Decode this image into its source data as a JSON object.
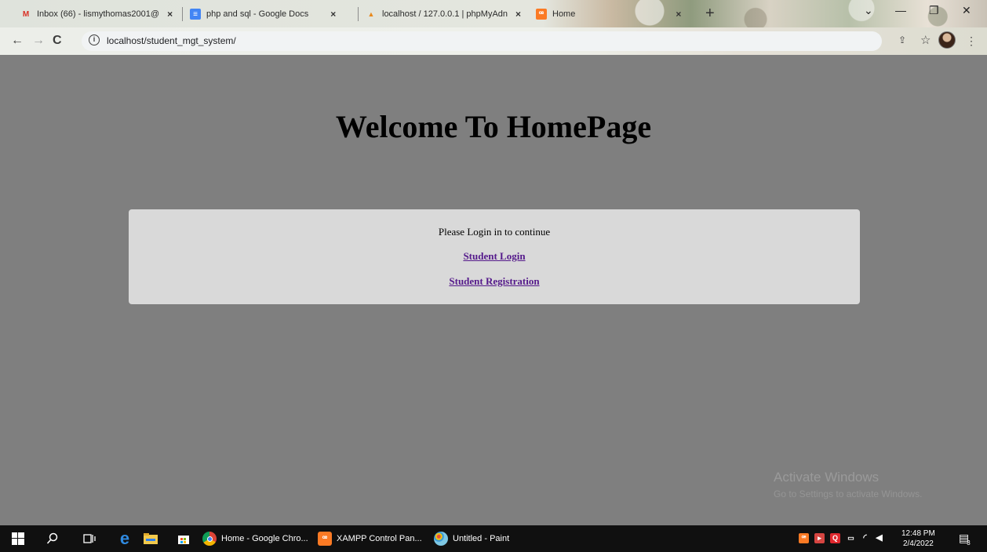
{
  "browser": {
    "tabs": [
      {
        "label": "Inbox (66) - lismythomas2001@",
        "icon": "gmail-icon",
        "close": "×"
      },
      {
        "label": "php and sql - Google Docs",
        "icon": "docs-icon",
        "close": "×"
      },
      {
        "label": "localhost / 127.0.0.1 | phpMyAdn",
        "icon": "phpmyadmin-icon",
        "close": "×"
      },
      {
        "label": "Home",
        "icon": "xampp-icon",
        "close": "×"
      }
    ],
    "new_tab": "+",
    "url": "localhost/student_mgt_system/",
    "info_glyph": "i"
  },
  "page": {
    "heading": "Welcome To HomePage",
    "login_prompt": "Please Login in to continue",
    "student_login": "Student Login",
    "student_registration": "Student Registration"
  },
  "watermark": {
    "title": "Activate Windows",
    "subtitle": "Go to Settings to activate Windows."
  },
  "taskbar": {
    "apps": [
      {
        "label": "Home - Google Chro...",
        "icon": "chrome-icon"
      },
      {
        "label": "XAMPP Control Pan...",
        "icon": "xampp-icon"
      },
      {
        "label": "Untitled - Paint",
        "icon": "paint-icon"
      }
    ],
    "time": "12:48 PM",
    "date": "2/4/2022",
    "notification_count": "3"
  },
  "colors": {
    "page_bg": "#7f7f7f",
    "box_bg": "#d9d9d9",
    "link": "#551a8b",
    "taskbar": "#101010"
  }
}
